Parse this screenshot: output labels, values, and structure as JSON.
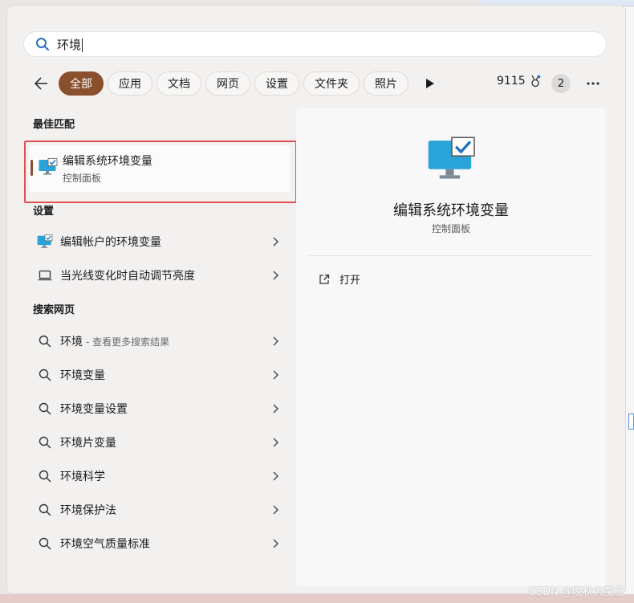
{
  "search": {
    "query": "环境"
  },
  "filters": {
    "tabs": [
      "全部",
      "应用",
      "文档",
      "网页",
      "设置",
      "文件夹",
      "照片"
    ],
    "active_index": 0,
    "points": "9115",
    "badge": "2"
  },
  "sections": {
    "best_match": "最佳匹配",
    "settings": "设置",
    "web": "搜索网页"
  },
  "best_match": {
    "title": "编辑系统环境变量",
    "subtitle": "控制面板"
  },
  "settings_items": [
    "编辑帐户的环境变量",
    "当光线变化时自动调节亮度"
  ],
  "web_items": [
    {
      "label": "环境",
      "hint": "- 查看更多搜索结果"
    },
    {
      "label": "环境变量"
    },
    {
      "label": "环境变量设置"
    },
    {
      "label": "环境片变量"
    },
    {
      "label": "环境科学"
    },
    {
      "label": "环境保护法"
    },
    {
      "label": "环境空气质量标准"
    }
  ],
  "preview": {
    "title": "编辑系统环境变量",
    "subtitle": "控制面板",
    "open_label": "打开"
  },
  "watermark": "CSDN @晚秋大魔王",
  "colors": {
    "accent": "#8a4f2c",
    "highlight_border": "#e05050",
    "search_icon": "#2a6fc0"
  }
}
